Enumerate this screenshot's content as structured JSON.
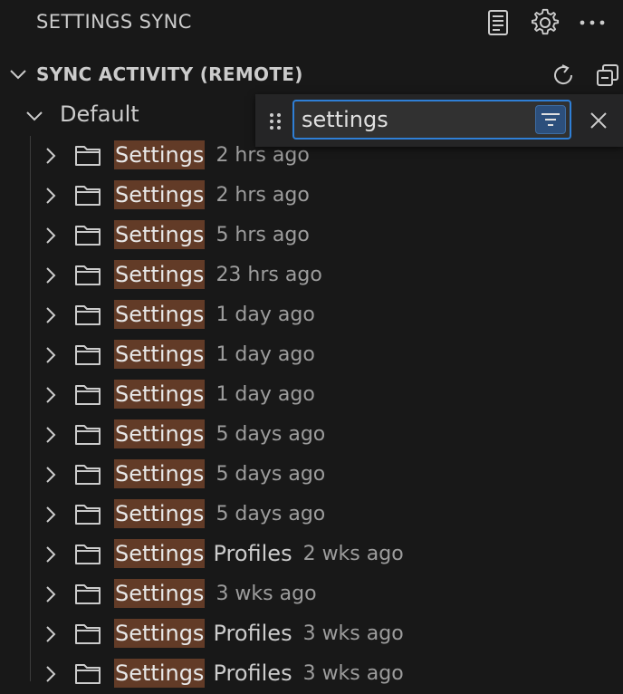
{
  "view": {
    "title": "SETTINGS SYNC",
    "icons": [
      "notes-icon",
      "gear-icon",
      "more-icon"
    ]
  },
  "section": {
    "title": "SYNC ACTIVITY (REMOTE)",
    "icons": [
      "refresh-icon",
      "collapse-all-icon"
    ]
  },
  "profile": {
    "label": "Default"
  },
  "filter": {
    "value": "settings",
    "icons": [
      "drag-grip-icon",
      "filter-icon",
      "close-icon"
    ]
  },
  "rows": [
    {
      "label": "Settings",
      "suffix": "",
      "time": "2 hrs ago"
    },
    {
      "label": "Settings",
      "suffix": "",
      "time": "2 hrs ago"
    },
    {
      "label": "Settings",
      "suffix": "",
      "time": "5 hrs ago"
    },
    {
      "label": "Settings",
      "suffix": "",
      "time": "23 hrs ago"
    },
    {
      "label": "Settings",
      "suffix": "",
      "time": "1 day ago"
    },
    {
      "label": "Settings",
      "suffix": "",
      "time": "1 day ago"
    },
    {
      "label": "Settings",
      "suffix": "",
      "time": "1 day ago"
    },
    {
      "label": "Settings",
      "suffix": "",
      "time": "5 days ago"
    },
    {
      "label": "Settings",
      "suffix": "",
      "time": "5 days ago"
    },
    {
      "label": "Settings",
      "suffix": "",
      "time": "5 days ago"
    },
    {
      "label": "Settings",
      "suffix": "Profiles",
      "time": "2 wks ago"
    },
    {
      "label": "Settings",
      "suffix": "",
      "time": "3 wks ago"
    },
    {
      "label": "Settings",
      "suffix": "Profiles",
      "time": "3 wks ago"
    },
    {
      "label": "Settings",
      "suffix": "Profiles",
      "time": "3 wks ago"
    }
  ],
  "colors": {
    "background": "#181818",
    "match_highlight": "#623b27",
    "focus_border": "#2f7fd6",
    "filter_active": "#2c4f7c"
  }
}
